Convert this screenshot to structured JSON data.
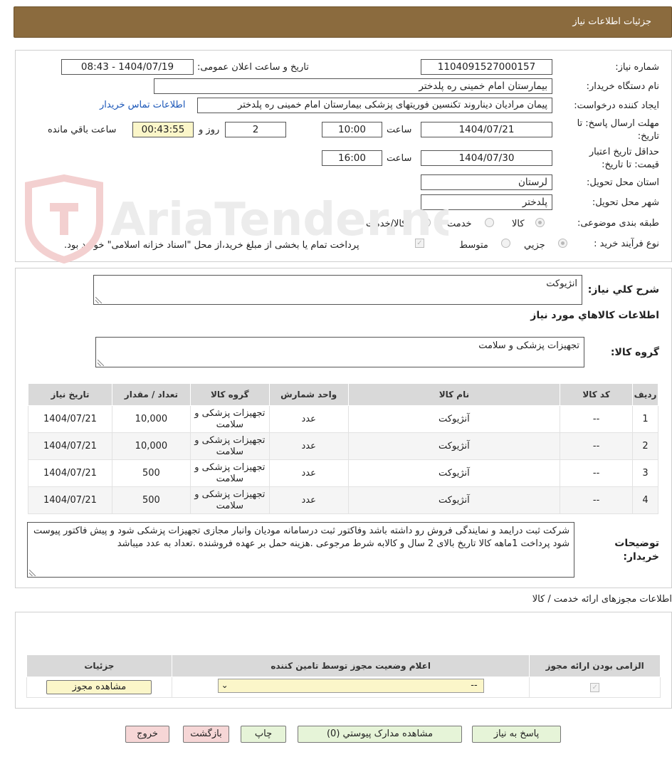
{
  "header": {
    "title": "جزئیات اطلاعات نیاز"
  },
  "form": {
    "need_number_label": "شماره نیاز:",
    "need_number": "1104091527000157",
    "announce_label": "تاریخ و ساعت اعلان عمومی:",
    "announce_value": "1404/07/19 - 08:43",
    "buyer_org_label": "نام دستگاه خریدار:",
    "buyer_org": "بیمارستان امام خمینی ره پلدختر",
    "creator_label": "ایجاد کننده درخواست:",
    "creator": "پیمان مرادیان دیناروند تکنسین فوریتهای پزشکی بیمارستان امام خمینی ره پلدختر",
    "contact_link": "اطلاعات تماس خریدار",
    "deadline_label_1": "مهلت ارسال پاسخ: تا",
    "deadline_label_2": "تاریخ:",
    "deadline_date": "1404/07/21",
    "time_label": "ساعت",
    "deadline_time": "10:00",
    "days_value": "2",
    "days_label": "روز و",
    "remaining_value": "00:43:55",
    "remaining_label": "ساعت باقي مانده",
    "validity_label_1": "حداقل تاریخ اعتبار",
    "validity_label_2": "قیمت: تا تاریخ:",
    "validity_date": "1404/07/30",
    "validity_time": "16:00",
    "province_label": "استان محل تحویل:",
    "province": "لرستان",
    "city_label": "شهر محل تحویل:",
    "city": "پلدختر",
    "category_label": "طبقه بندی موضوعی:",
    "category_options": [
      "کالا",
      "خدمت",
      "کالا/خدمت"
    ],
    "process_label": "نوع فرآیند خرید :",
    "process_options": [
      "جزیي",
      "متوسط"
    ],
    "payment_note": "پرداخت تمام یا بخشی از مبلغ خرید،از محل \"اسناد خزانه اسلامی\" خواهد بود."
  },
  "summary": {
    "general_label": "شرح كلي نياز:",
    "general_value": "انژیوکت",
    "goods_info_title": "اطلاعات كالاهاي مورد نياز",
    "goods_group_label": "گروه كالا:",
    "goods_group_value": "تجهیزات پزشکی و سلامت"
  },
  "items_table": {
    "headers": [
      "رديف",
      "كد كالا",
      "نام كالا",
      "واحد شمارش",
      "گروه كالا",
      "تعداد / مقدار",
      "تاريخ نياز"
    ],
    "rows": [
      {
        "idx": "1",
        "code": "--",
        "name": "آنژیوکت",
        "unit": "عدد",
        "group": "تجهیزات پزشکی و سلامت",
        "qty": "10,000",
        "date": "1404/07/21"
      },
      {
        "idx": "2",
        "code": "--",
        "name": "آنژیوکت",
        "unit": "عدد",
        "group": "تجهیزات پزشکی و سلامت",
        "qty": "10,000",
        "date": "1404/07/21"
      },
      {
        "idx": "3",
        "code": "--",
        "name": "آنژیوکت",
        "unit": "عدد",
        "group": "تجهیزات پزشکی و سلامت",
        "qty": "500",
        "date": "1404/07/21"
      },
      {
        "idx": "4",
        "code": "--",
        "name": "آنژیوکت",
        "unit": "عدد",
        "group": "تجهیزات پزشکی و سلامت",
        "qty": "500",
        "date": "1404/07/21"
      }
    ]
  },
  "buyer_notes": {
    "label_1": "توضیحات",
    "label_2": "خریدار:",
    "text": "شرکت ثبت درایمد و نمایندگی فروش رو داشته باشد وفاکتور ثبت درسامانه مودیان وانبار مجازی تجهیزات پزشکی شود و پیش فاکتور پیوست شود پرداخت 1ماهه کالا تاریخ بالای 2 سال و کالابه شرط مرجوعی .هزینه حمل بر عهده فروشنده .تعداد به عدد میباشد"
  },
  "licenses": {
    "section_title": "اطلاعات مجوزهای ارائه خدمت / کالا",
    "headers": [
      "الزامی بودن ارائه مجوز",
      "اعلام وضعیت مجوز توسط تامین کننده",
      "جزئیات"
    ],
    "select_value": "--",
    "view_button": "مشاهده مجوز"
  },
  "footer": {
    "reply_button": "پاسخ به نیاز",
    "attachments_button": "مشاهده مدارک پیوستي (0)",
    "print_button": "چاپ",
    "back_button": "بازگشت",
    "exit_button": "خروج"
  },
  "watermark": {
    "text": "AriaTender.neT"
  },
  "colors": {
    "header_bg": "#8b6b3e",
    "button_green": "#e6f4d8",
    "button_red": "#f6d6d6",
    "link": "#1a56b8"
  }
}
